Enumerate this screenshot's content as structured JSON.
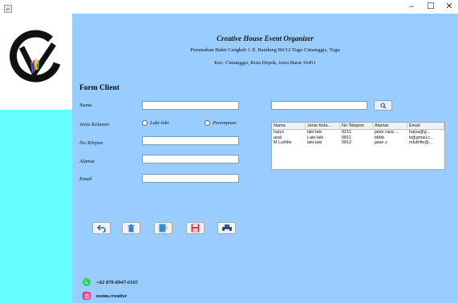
{
  "window": {
    "minimize": "–",
    "maximize": "☐",
    "close": "✕"
  },
  "header": {
    "title": "Creative House Event Organizer",
    "address_line1": "Perumahan Bukit Cengkeh 1 Jl. Bandung B6/12 Tugu Cimanggis, Tugu",
    "address_line2": "Kec. Cimanggis, Kota Depok, Jawa Barat 16451"
  },
  "form": {
    "title": "Form Client",
    "nama_label": "Nama",
    "nama_value": "",
    "jenis_kelamin_label": "Jenis Kelamin",
    "radio_male": "Laki-laki",
    "radio_female": "Perempuan",
    "telepon_label": "No.Telepon",
    "telepon_value": "",
    "alamat_label": "Alamat",
    "alamat_value": "",
    "email_label": "Email",
    "email_value": ""
  },
  "search": {
    "value": ""
  },
  "table": {
    "columns": [
      "Nama",
      "Jenis Kela...",
      "No Telepon",
      "Alamat",
      "Email"
    ],
    "rows": [
      [
        "haiyo",
        "laki-laki",
        "0211",
        "jalan raya ...",
        "haiya@g..."
      ],
      [
        "asal",
        "Laki-laki",
        "0811",
        "bbbb",
        "b@gmail.c..."
      ],
      [
        "M Luthfie",
        "laki-laki",
        "0812",
        "jalan z",
        "mluthfie@..."
      ]
    ]
  },
  "contacts": {
    "phone": "+62 878-8947-0165",
    "instagram": "nomu.creative"
  }
}
